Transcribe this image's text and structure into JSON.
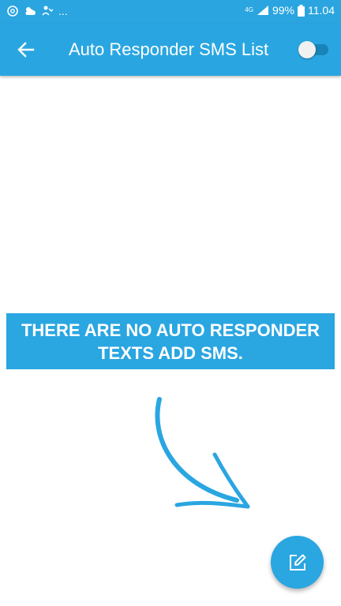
{
  "status_bar": {
    "overflow_text": "...",
    "network": "4G",
    "battery": "99%",
    "time": "11.04"
  },
  "app_bar": {
    "title": "Auto Responder SMS List",
    "toggle_state": "off"
  },
  "empty_state": {
    "message": "THERE ARE NO AUTO RESPONDER\nTEXTS ADD SMS."
  },
  "icons": {
    "back": "arrow-left-icon",
    "fab": "edit-icon",
    "illustration": "curved-arrow-icon"
  },
  "colors": {
    "primary": "#29a6e1",
    "on_primary": "#ffffff",
    "background": "#ffffff"
  }
}
